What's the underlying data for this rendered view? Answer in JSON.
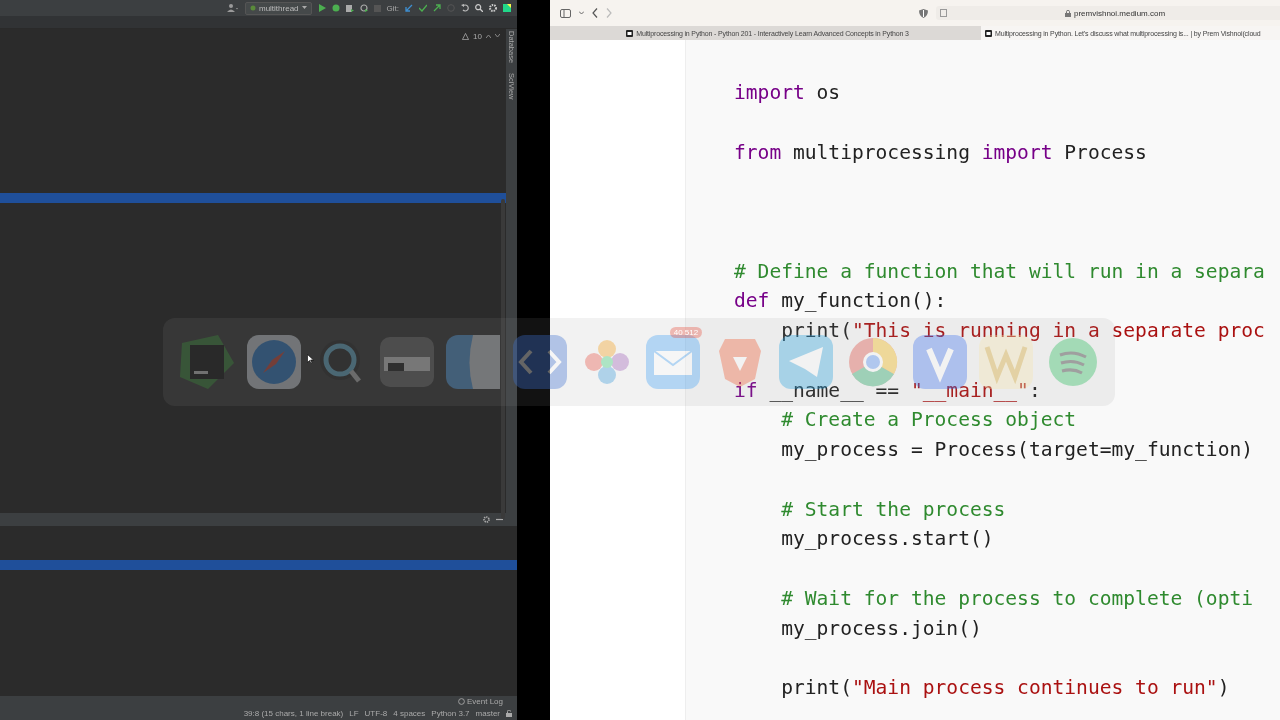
{
  "ide": {
    "run_config": "multithread",
    "vcs_label": "Git:",
    "warnings": "10",
    "side_tabs": [
      "Database",
      "SciView"
    ],
    "event_log": "Event Log",
    "status_bar": [
      "39:8 (15 chars, 1 line break)",
      "LF",
      "UTF-8",
      "4 spaces",
      "Python 3.7",
      "master"
    ]
  },
  "browser": {
    "address": "premvishnoi.medium.com",
    "tabs": [
      {
        "title": "Multiprocessing in Python - Python 201 - Interactively Learn Advanced Concepts in Python 3",
        "selected": false
      },
      {
        "title": "Multiprocessing in Python. Let's discuss what multiprocessing is... | by Prem Vishnoi(cloud",
        "selected": true
      }
    ],
    "code": [
      {
        "kind": "code",
        "tokens": [
          {
            "kind": "keyword",
            "text": "import"
          },
          {
            "kind": "plain",
            "text": " os"
          }
        ]
      },
      {
        "kind": "blank"
      },
      {
        "kind": "code",
        "tokens": [
          {
            "kind": "keyword",
            "text": "from"
          },
          {
            "kind": "plain",
            "text": " multiprocessing "
          },
          {
            "kind": "keyword",
            "text": "import"
          },
          {
            "kind": "plain",
            "text": " Process"
          }
        ]
      },
      {
        "kind": "blank"
      },
      {
        "kind": "blank"
      },
      {
        "kind": "blank"
      },
      {
        "kind": "code",
        "tokens": [
          {
            "kind": "comment",
            "text": "# Define a function that will run in a separa"
          }
        ]
      },
      {
        "kind": "code",
        "tokens": [
          {
            "kind": "keyword",
            "text": "def"
          },
          {
            "kind": "plain",
            "text": " my_function():"
          }
        ]
      },
      {
        "kind": "code",
        "tokens": [
          {
            "kind": "plain",
            "text": "    print("
          },
          {
            "kind": "string",
            "text": "\"This is running in a separate proc"
          }
        ]
      },
      {
        "kind": "blank"
      },
      {
        "kind": "code",
        "tokens": [
          {
            "kind": "keyword",
            "text": "if"
          },
          {
            "kind": "plain",
            "text": " __name__ == "
          },
          {
            "kind": "string",
            "text": "\"__main__\""
          },
          {
            "kind": "plain",
            "text": ":"
          }
        ]
      },
      {
        "kind": "code",
        "tokens": [
          {
            "kind": "comment",
            "text": "    # Create a Process object"
          }
        ]
      },
      {
        "kind": "code",
        "tokens": [
          {
            "kind": "plain",
            "text": "    my_process = Process(target=my_function)"
          }
        ]
      },
      {
        "kind": "blank"
      },
      {
        "kind": "code",
        "tokens": [
          {
            "kind": "comment",
            "text": "    # Start the process"
          }
        ]
      },
      {
        "kind": "code",
        "tokens": [
          {
            "kind": "plain",
            "text": "    my_process.start()"
          }
        ]
      },
      {
        "kind": "blank"
      },
      {
        "kind": "code",
        "tokens": [
          {
            "kind": "comment",
            "text": "    # Wait for the process to complete (opti"
          }
        ]
      },
      {
        "kind": "code",
        "tokens": [
          {
            "kind": "plain",
            "text": "    my_process.join()"
          }
        ]
      },
      {
        "kind": "blank"
      },
      {
        "kind": "code",
        "tokens": [
          {
            "kind": "plain",
            "text": "    print("
          },
          {
            "kind": "string",
            "text": "\"Main process continues to run\""
          },
          {
            "kind": "plain",
            "text": ")"
          }
        ]
      }
    ]
  },
  "app_switcher": {
    "mail_badge": "40 512"
  }
}
